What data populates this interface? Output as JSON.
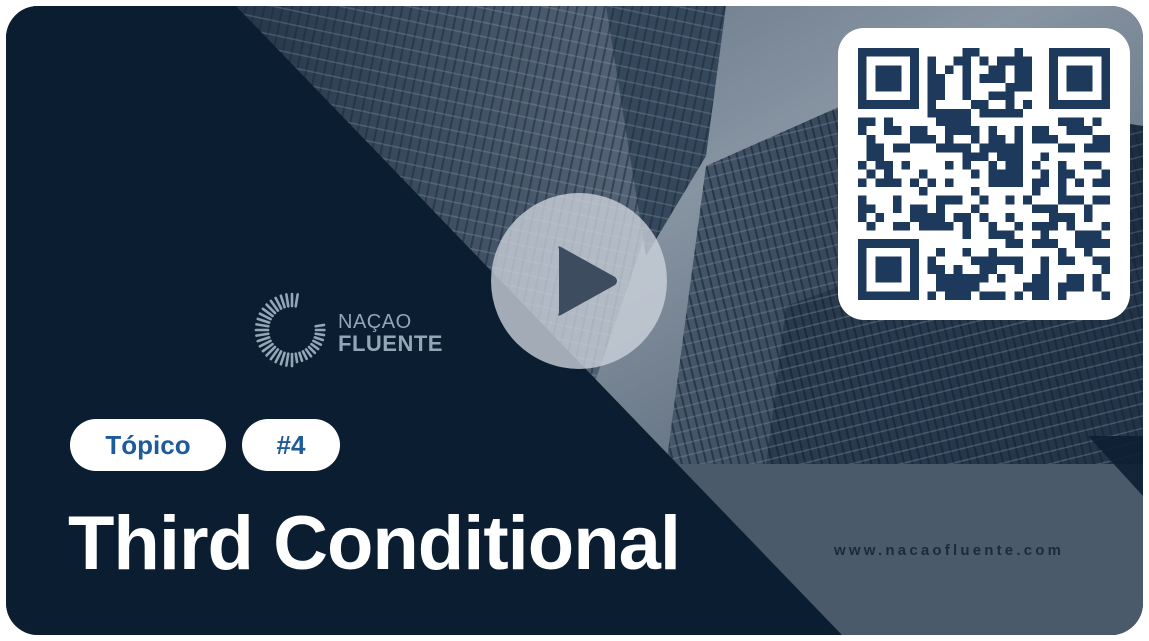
{
  "thumbnail": {
    "brand": {
      "line1": "NAÇAO",
      "line2": "FLUENTE"
    },
    "tag_label": "Tópico",
    "tag_number": "#4",
    "title": "Third Conditional",
    "website": "www.nacaofluente.com",
    "icons": {
      "play": "play-icon",
      "qr": "qr-code",
      "logo": "logo-ring-icon"
    },
    "colors": {
      "background_dark": "#0d2033",
      "pill_text": "#1d5b9a",
      "title_text": "#ffffff",
      "slate_panel": "#5a6878"
    }
  }
}
